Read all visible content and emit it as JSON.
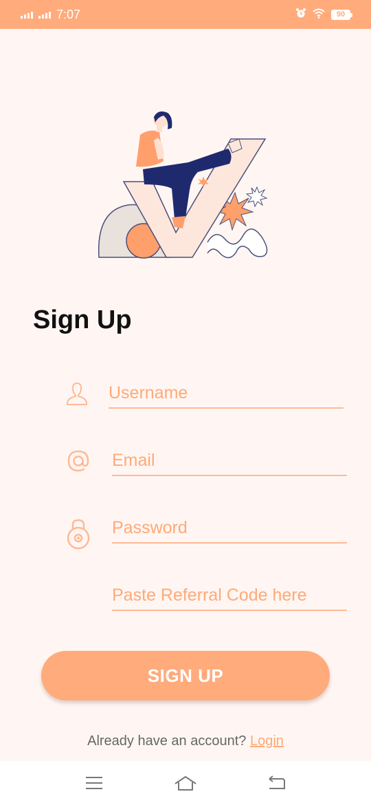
{
  "status_bar": {
    "time": "7:07",
    "battery": "90",
    "background": "#ffab7c"
  },
  "page": {
    "title": "Sign Up",
    "accent": "#ffab7c"
  },
  "form": {
    "username": {
      "placeholder": "Username",
      "value": "",
      "icon": "user-icon"
    },
    "email": {
      "placeholder": "Email",
      "value": "",
      "icon": "at-icon"
    },
    "password": {
      "placeholder": "Password",
      "value": "",
      "icon": "lock-icon"
    },
    "referral": {
      "placeholder": "Paste Referral Code here",
      "value": ""
    }
  },
  "actions": {
    "signup_label": "SIGN UP",
    "login_prompt": "Already have an account?",
    "login_link": "Login"
  },
  "nav": {
    "items": [
      "menu-icon",
      "home-icon",
      "back-icon"
    ]
  }
}
